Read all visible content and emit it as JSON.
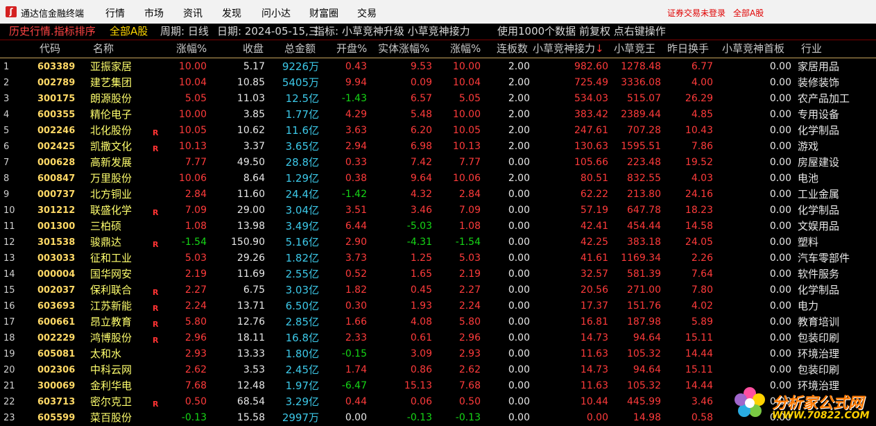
{
  "app": {
    "title": "通达信金融终端",
    "menu": [
      "行情",
      "市场",
      "资讯",
      "发现",
      "问小达",
      "财富圈",
      "交易"
    ],
    "login_status": "证券交易未登录",
    "market": "全部A股"
  },
  "infobar": {
    "mode": "历史行情.指标排序",
    "market": "全部A股",
    "period": "周期: 日线",
    "date": "日期: 2024-05-15,三",
    "indicator": "指标: 小草竞神升级 小草竞神接力",
    "data_info": "使用1000个数据 前复权 点右键操作"
  },
  "table": {
    "headers": [
      "代码",
      "名称",
      "涨幅%",
      "收盘",
      "总金额",
      "开盘%",
      "实体涨幅%",
      "涨幅%",
      "连板数",
      "小草竞神接力",
      "小草竞王",
      "昨日换手",
      "小草竞神首板",
      "行业"
    ],
    "sort_marker": "↓",
    "rows": [
      {
        "idx": "1",
        "code": "603389",
        "name": "亚振家居",
        "flag": "",
        "rise": "10.00",
        "close": "5.17",
        "amount": "9226万",
        "open": "0.43",
        "body": "9.53",
        "rise2": "10.00",
        "boards": "2.00",
        "relay": "982.60",
        "king": "1278.48",
        "turnover": "6.77",
        "first": "0.00",
        "industry": "家居用品",
        "rise_c": "red",
        "open_c": "red",
        "body_c": "red"
      },
      {
        "idx": "2",
        "code": "002789",
        "name": "建艺集团",
        "flag": "",
        "rise": "10.04",
        "close": "10.85",
        "amount": "5405万",
        "open": "9.94",
        "body": "0.09",
        "rise2": "10.04",
        "boards": "2.00",
        "relay": "725.49",
        "king": "3336.08",
        "turnover": "4.00",
        "first": "0.00",
        "industry": "装修装饰",
        "rise_c": "red",
        "open_c": "red",
        "body_c": "red"
      },
      {
        "idx": "3",
        "code": "300175",
        "name": "朗源股份",
        "flag": "",
        "rise": "5.05",
        "close": "11.03",
        "amount": "12.5亿",
        "open": "-1.43",
        "body": "6.57",
        "rise2": "5.05",
        "boards": "2.00",
        "relay": "534.03",
        "king": "515.07",
        "turnover": "26.29",
        "first": "0.00",
        "industry": "农产品加工",
        "rise_c": "red",
        "open_c": "green",
        "body_c": "red"
      },
      {
        "idx": "4",
        "code": "600355",
        "name": "精伦电子",
        "flag": "",
        "rise": "10.00",
        "close": "3.85",
        "amount": "1.77亿",
        "open": "4.29",
        "body": "5.48",
        "rise2": "10.00",
        "boards": "2.00",
        "relay": "383.42",
        "king": "2389.44",
        "turnover": "4.85",
        "first": "0.00",
        "industry": "专用设备",
        "rise_c": "red",
        "open_c": "red",
        "body_c": "red"
      },
      {
        "idx": "5",
        "code": "002246",
        "name": "北化股份",
        "flag": "R",
        "rise": "10.05",
        "close": "10.62",
        "amount": "11.6亿",
        "open": "3.63",
        "body": "6.20",
        "rise2": "10.05",
        "boards": "2.00",
        "relay": "247.61",
        "king": "707.28",
        "turnover": "10.43",
        "first": "0.00",
        "industry": "化学制品",
        "rise_c": "red",
        "open_c": "red",
        "body_c": "red"
      },
      {
        "idx": "6",
        "code": "002425",
        "name": "凯撒文化",
        "flag": "R",
        "rise": "10.13",
        "close": "3.37",
        "amount": "3.65亿",
        "open": "2.94",
        "body": "6.98",
        "rise2": "10.13",
        "boards": "2.00",
        "relay": "130.63",
        "king": "1595.51",
        "turnover": "7.86",
        "first": "0.00",
        "industry": "游戏",
        "rise_c": "red",
        "open_c": "red",
        "body_c": "red"
      },
      {
        "idx": "7",
        "code": "000628",
        "name": "高新发展",
        "flag": "",
        "rise": "7.77",
        "close": "49.50",
        "amount": "28.8亿",
        "open": "0.33",
        "body": "7.42",
        "rise2": "7.77",
        "boards": "0.00",
        "relay": "105.66",
        "king": "223.48",
        "turnover": "19.52",
        "first": "0.00",
        "industry": "房屋建设",
        "rise_c": "red",
        "open_c": "red",
        "body_c": "red"
      },
      {
        "idx": "8",
        "code": "600847",
        "name": "万里股份",
        "flag": "",
        "rise": "10.06",
        "close": "8.64",
        "amount": "1.29亿",
        "open": "0.38",
        "body": "9.64",
        "rise2": "10.06",
        "boards": "2.00",
        "relay": "80.51",
        "king": "832.55",
        "turnover": "4.03",
        "first": "0.00",
        "industry": "电池",
        "rise_c": "red",
        "open_c": "red",
        "body_c": "red"
      },
      {
        "idx": "9",
        "code": "000737",
        "name": "北方铜业",
        "flag": "",
        "rise": "2.84",
        "close": "11.60",
        "amount": "24.4亿",
        "open": "-1.42",
        "body": "4.32",
        "rise2": "2.84",
        "boards": "0.00",
        "relay": "62.22",
        "king": "213.80",
        "turnover": "24.16",
        "first": "0.00",
        "industry": "工业金属",
        "rise_c": "red",
        "open_c": "green",
        "body_c": "red"
      },
      {
        "idx": "10",
        "code": "301212",
        "name": "联盛化学",
        "flag": "R",
        "rise": "7.09",
        "close": "29.00",
        "amount": "3.04亿",
        "open": "3.51",
        "body": "3.46",
        "rise2": "7.09",
        "boards": "0.00",
        "relay": "57.19",
        "king": "647.78",
        "turnover": "18.23",
        "first": "0.00",
        "industry": "化学制品",
        "rise_c": "red",
        "open_c": "red",
        "body_c": "red"
      },
      {
        "idx": "11",
        "code": "001300",
        "name": "三柏硕",
        "flag": "",
        "rise": "1.08",
        "close": "13.98",
        "amount": "3.49亿",
        "open": "6.44",
        "body": "-5.03",
        "rise2": "1.08",
        "boards": "0.00",
        "relay": "42.41",
        "king": "454.44",
        "turnover": "14.58",
        "first": "0.00",
        "industry": "文娱用品",
        "rise_c": "red",
        "open_c": "red",
        "body_c": "green"
      },
      {
        "idx": "12",
        "code": "301538",
        "name": "骏鼎达",
        "flag": "R",
        "rise": "-1.54",
        "close": "150.90",
        "amount": "5.16亿",
        "open": "2.90",
        "body": "-4.31",
        "rise2": "-1.54",
        "boards": "0.00",
        "relay": "42.25",
        "king": "383.18",
        "turnover": "24.05",
        "first": "0.00",
        "industry": "塑料",
        "rise_c": "green",
        "open_c": "red",
        "body_c": "green"
      },
      {
        "idx": "13",
        "code": "003033",
        "name": "征和工业",
        "flag": "",
        "rise": "5.03",
        "close": "29.26",
        "amount": "1.82亿",
        "open": "3.73",
        "body": "1.25",
        "rise2": "5.03",
        "boards": "0.00",
        "relay": "41.61",
        "king": "1169.34",
        "turnover": "2.26",
        "first": "0.00",
        "industry": "汽车零部件",
        "rise_c": "red",
        "open_c": "red",
        "body_c": "red"
      },
      {
        "idx": "14",
        "code": "000004",
        "name": "国华网安",
        "flag": "",
        "rise": "2.19",
        "close": "11.69",
        "amount": "2.55亿",
        "open": "0.52",
        "body": "1.65",
        "rise2": "2.19",
        "boards": "0.00",
        "relay": "32.57",
        "king": "581.39",
        "turnover": "7.64",
        "first": "0.00",
        "industry": "软件服务",
        "rise_c": "red",
        "open_c": "red",
        "body_c": "red"
      },
      {
        "idx": "15",
        "code": "002037",
        "name": "保利联合",
        "flag": "R",
        "rise": "2.27",
        "close": "6.75",
        "amount": "3.03亿",
        "open": "1.82",
        "body": "0.45",
        "rise2": "2.27",
        "boards": "0.00",
        "relay": "20.56",
        "king": "271.00",
        "turnover": "7.80",
        "first": "0.00",
        "industry": "化学制品",
        "rise_c": "red",
        "open_c": "red",
        "body_c": "red"
      },
      {
        "idx": "16",
        "code": "603693",
        "name": "江苏新能",
        "flag": "R",
        "rise": "2.24",
        "close": "13.71",
        "amount": "6.50亿",
        "open": "0.30",
        "body": "1.93",
        "rise2": "2.24",
        "boards": "0.00",
        "relay": "17.37",
        "king": "151.76",
        "turnover": "4.02",
        "first": "0.00",
        "industry": "电力",
        "rise_c": "red",
        "open_c": "red",
        "body_c": "red"
      },
      {
        "idx": "17",
        "code": "600661",
        "name": "昂立教育",
        "flag": "R",
        "rise": "5.80",
        "close": "12.76",
        "amount": "2.85亿",
        "open": "1.66",
        "body": "4.08",
        "rise2": "5.80",
        "boards": "0.00",
        "relay": "16.81",
        "king": "187.98",
        "turnover": "5.89",
        "first": "0.00",
        "industry": "教育培训",
        "rise_c": "red",
        "open_c": "red",
        "body_c": "red"
      },
      {
        "idx": "18",
        "code": "002229",
        "name": "鸿博股份",
        "flag": "R",
        "rise": "2.96",
        "close": "18.11",
        "amount": "16.8亿",
        "open": "2.33",
        "body": "0.61",
        "rise2": "2.96",
        "boards": "0.00",
        "relay": "14.73",
        "king": "94.64",
        "turnover": "15.11",
        "first": "0.00",
        "industry": "包装印刷",
        "rise_c": "red",
        "open_c": "red",
        "body_c": "red"
      },
      {
        "idx": "19",
        "code": "605081",
        "name": "太和水",
        "flag": "",
        "rise": "2.93",
        "close": "13.33",
        "amount": "1.80亿",
        "open": "-0.15",
        "body": "3.09",
        "rise2": "2.93",
        "boards": "0.00",
        "relay": "11.63",
        "king": "105.32",
        "turnover": "14.44",
        "first": "0.00",
        "industry": "环境治理",
        "rise_c": "red",
        "open_c": "green",
        "body_c": "red"
      },
      {
        "idx": "20",
        "code": "002306",
        "name": "中科云网",
        "flag": "",
        "rise": "2.62",
        "close": "3.53",
        "amount": "2.45亿",
        "open": "1.74",
        "body": "0.86",
        "rise2": "2.62",
        "boards": "0.00",
        "relay": "14.73",
        "king": "94.64",
        "turnover": "15.11",
        "first": "0.00",
        "industry": "包装印刷",
        "rise_c": "red",
        "open_c": "red",
        "body_c": "red"
      },
      {
        "idx": "21",
        "code": "300069",
        "name": "金利华电",
        "flag": "",
        "rise": "7.68",
        "close": "12.48",
        "amount": "1.97亿",
        "open": "-6.47",
        "body": "15.13",
        "rise2": "7.68",
        "boards": "0.00",
        "relay": "11.63",
        "king": "105.32",
        "turnover": "14.44",
        "first": "0.00",
        "industry": "环境治理",
        "rise_c": "red",
        "open_c": "green",
        "body_c": "red"
      },
      {
        "idx": "22",
        "code": "603713",
        "name": "密尔克卫",
        "flag": "R",
        "rise": "0.50",
        "close": "68.54",
        "amount": "3.29亿",
        "open": "0.44",
        "body": "0.06",
        "rise2": "0.50",
        "boards": "0.00",
        "relay": "10.44",
        "king": "445.99",
        "turnover": "3.46",
        "first": "0.00",
        "industry": "",
        "rise_c": "red",
        "open_c": "red",
        "body_c": "red"
      },
      {
        "idx": "23",
        "code": "605599",
        "name": "菜百股份",
        "flag": "",
        "rise": "-0.13",
        "close": "15.58",
        "amount": "2997万",
        "open": "0.00",
        "body": "-0.13",
        "rise2": "-0.13",
        "boards": "0.00",
        "relay": "0.00",
        "king": "14.98",
        "turnover": "0.58",
        "first": "0.00",
        "industry": "",
        "rise_c": "green",
        "open_c": "white",
        "body_c": "green"
      }
    ]
  },
  "watermark": {
    "text": "分析家公式网",
    "url": "WWW.70822.COM"
  },
  "colors": {
    "up": "#ff3b3b",
    "down": "#16d616",
    "code": "#ffd966",
    "name": "#ffff6e",
    "amount": "#3cc8e8"
  }
}
